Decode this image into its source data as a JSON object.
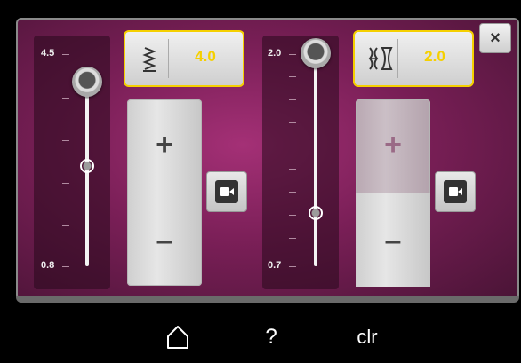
{
  "close": {
    "label": "×",
    "icon": "close-icon"
  },
  "width_control": {
    "slider": {
      "max_label": "4.5",
      "min_label": "0.8",
      "value": 4.0,
      "min": 0.8,
      "max": 4.5
    },
    "value_display": {
      "value": "4.0",
      "icon": "stitch-width-icon"
    },
    "stepper": {
      "plus": "+",
      "minus": "–"
    },
    "camera_icon": "video-camera-icon"
  },
  "length_control": {
    "slider": {
      "max_label": "2.0",
      "min_label": "0.7",
      "value": 2.0,
      "min": 0.7,
      "max": 2.0
    },
    "value_display": {
      "value": "2.0",
      "icon": "stitch-length-icon"
    },
    "stepper": {
      "plus": "+",
      "minus": "–"
    },
    "camera_icon": "video-camera-icon"
  },
  "footer": {
    "home_icon": "home-icon",
    "help_label": "?",
    "clear_label": "clr"
  },
  "colors": {
    "accent": "#f5d000",
    "panel": "#8e2565"
  }
}
